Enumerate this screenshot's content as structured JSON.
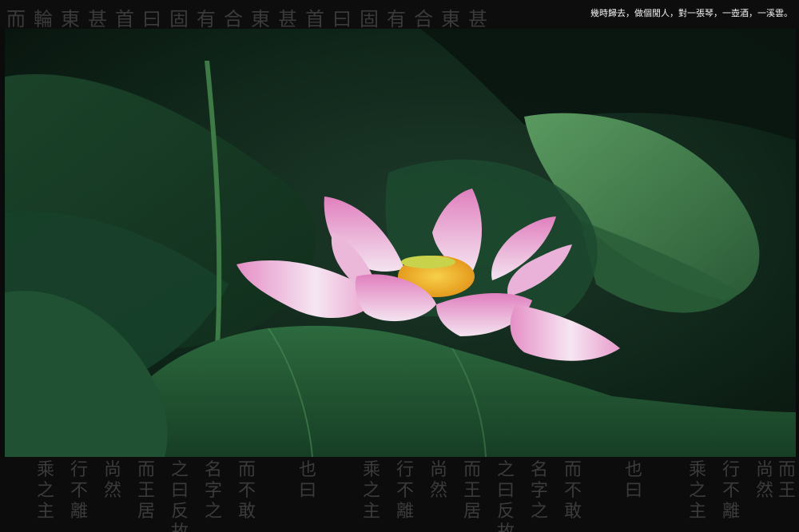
{
  "caption": "幾時歸去，做個閒人，對一張琴，一壺酒，一溪雲。",
  "top_calligraphy": "而輪東甚首曰固有合東甚首曰固有合東甚",
  "bottom_calligraphy_columns": [
    "乘之主",
    "行不離",
    "尚然",
    "而王居",
    "之曰反故",
    "名字之",
    "而不敢",
    "也曰",
    "乘之主",
    "行不離",
    "尚然",
    "而王居",
    "之曰反故",
    "名字之",
    "而不敢",
    "也曰",
    "乘之主",
    "行不離",
    "尚然",
    "而王"
  ],
  "colors": {
    "background": "#0b0b0b",
    "leaf_dark": "#0f2a1c",
    "leaf_light": "#3f7a4a",
    "petal": "#e9a9d4",
    "stamen": "#f2b430"
  }
}
